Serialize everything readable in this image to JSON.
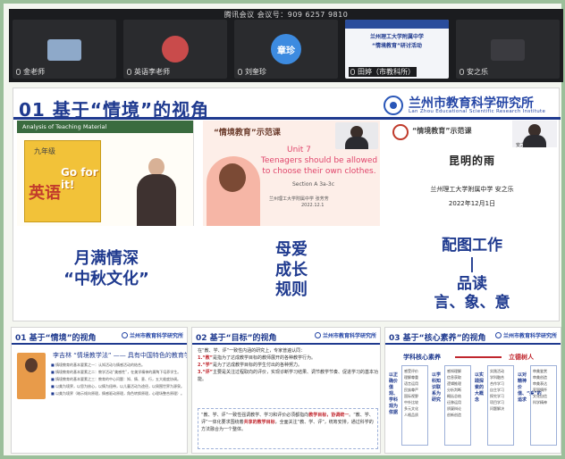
{
  "meeting": {
    "title": "腾讯会议 会议号：909 6257 9810",
    "tiles": [
      {
        "name": "金老师",
        "thumb_color": "#8ea9c9"
      },
      {
        "name": "英语李老师",
        "thumb_color": "#c94b4b"
      },
      {
        "name": "刘奎珍",
        "avatar_text": "章珍",
        "avatar_color": "#3d8be0"
      },
      {
        "name": "田婷（市教科所）",
        "slide_text": "兰州理工大学附属中学",
        "slide_sub": "“情境教育”研讨活动"
      },
      {
        "name": "安之乐"
      }
    ]
  },
  "main_slide": {
    "title": "01 基于“情境”的视角",
    "logo_cn": "兰州市教育科学研究所",
    "logo_en": "Lan Zhou Educational Scientific Research Institute",
    "panel1": {
      "header": "Analysis of Teaching Material",
      "book_top": "九年级",
      "book_big": "英语",
      "book_go": "Go for it!",
      "caption_1": "月满情深",
      "caption_2": "“中秋文化”"
    },
    "panel2": {
      "tag": "“情境教育”示范课",
      "unit": "Unit 7",
      "line_1": "Teenagers should be allowed",
      "line_2": "to choose their own clothes.",
      "section": "Section A  3a-3c",
      "school": "兰州理工大学附属中学  张芳芳",
      "date": "2022.12.1",
      "caption_1": "母爱",
      "caption_2": "成长",
      "caption_3": "规则"
    },
    "panel3": {
      "tag": "“情境教育”示范课",
      "cam_name": "安之乐",
      "main_text": "昆明的雨",
      "school": "兰州理工大学附属中学    安之乐",
      "date": "2022年12月1日",
      "caption_1": "配图工作",
      "caption_2": "|",
      "caption_3": "品读",
      "caption_4": "言、象、意"
    }
  },
  "mini_slides": [
    {
      "title": "01 基于“情境”的视角",
      "logo": "兰州市教育科学研究所",
      "head": "李吉林 “情境教学法” —— 具有中国特色的教育学",
      "lines": [
        "情境教育的基本要素之一：认知活动与情感活动的结合。",
        "情境教育的基本要素之二：教学活动“美感性”，在美学精神的熏陶下培养学生。",
        "情境教育的基本要素之三：教育的中心问题：知、情、意、行，五大维度协调。",
        "以美为境界，以思为核心，以情为纽带，以儿童活动为途径，以周围世界为源泉。",
        "以美为境界（暗示倾向原理，情感驱动原理，角色转换原理，心理场整合原理）。"
      ]
    },
    {
      "title": "02 基于“目标”的视角",
      "logo": "兰州市教育科学研究所",
      "intro": "在“教、学、评”一致性内涵的研究上，专家普遍认同：",
      "item_1a": "1.“教”",
      "item_1b": "是指为了达成教学目标的教师展开的各种教学行为。",
      "item_2a": "2.“学”",
      "item_2b": "是为了达成教学目标的学生付出的各种努力。",
      "item_3a": "3.“评”",
      "item_3b": "主要是关注过程取向的评价，实现诊断学习结果、调节教学节奏、促进学习的基本功能。",
      "box_a": "“教、学、评”一致性强调教学、学习和评价必须都指向",
      "box_hl_1": "教学目标，",
      "box_hl_2": "协调统一",
      "box_b": "。“教、学、评”一体化要求围绕着",
      "box_hl_3": "共享的教学目标",
      "box_c": "，全面关注“教、学、评”，统筹安排，通过科学的方法融合为一个整体。"
    },
    {
      "title": "03 基于“核心素养”的视角",
      "logo": "兰州市教育科学研究所",
      "core": "学科核心素养",
      "goal": "立德树人",
      "columns": [
        {
          "label": "以正确价值观、学科观为依据",
          "items": [
            "感受评价",
            "理解尊重",
            "语言运用",
            "民族尊严",
            "国际视野",
            "中外比较",
            "多元文化",
            "人格品质"
          ]
        },
        {
          "label": "以学科知识联系为研究",
          "items": [
            "感知理解",
            "信息获取",
            "逻辑推理",
            "分析判断",
            "概括总结",
            "迁移运用",
            "质疑辩论",
            "创新创造"
          ]
        },
        {
          "label": "以实践探索的大概念",
          "items": [
            "实践活动",
            "学科融合",
            "合作学习",
            "自主学习",
            "探究学习",
            "项目学习",
            "问题解决"
          ]
        },
        {
          "label": "以对精神价值、“美”的追求",
          "items": [
            "审美鉴赏",
            "审美创造",
            "审美表达",
            "家国情怀",
            "文化自信",
            "科学精神"
          ]
        }
      ]
    }
  ]
}
